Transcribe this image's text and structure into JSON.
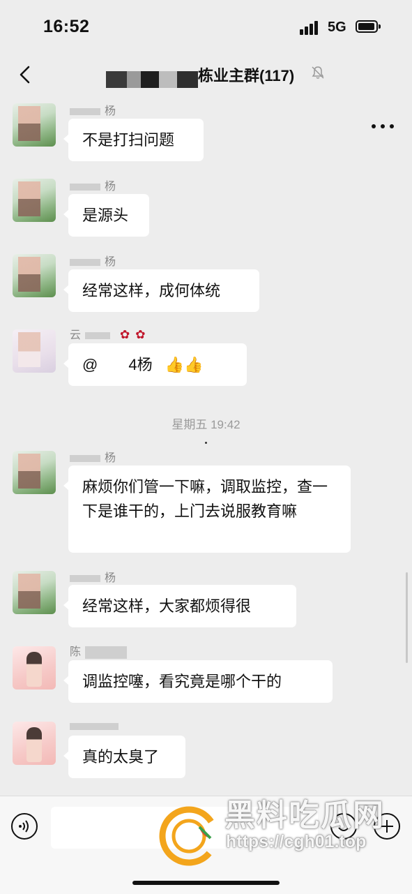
{
  "status_bar": {
    "time": "16:52",
    "network": "5G"
  },
  "header": {
    "title": "栋业主群(117)"
  },
  "messages": [
    {
      "sender": "杨",
      "text": "不是打扫问题"
    },
    {
      "sender": "杨",
      "text": "是源头"
    },
    {
      "sender": "杨",
      "text": "经常这样，成何体统"
    },
    {
      "sender": "云",
      "text": "@",
      "mention_suffix": "4杨"
    },
    {
      "sender": "杨",
      "text": "麻烦你们管一下嘛，调取监控，查一下是谁干的，上门去说服教育嘛"
    },
    {
      "sender": "杨",
      "text": "经常这样，大家都烦得很"
    },
    {
      "sender": "陈",
      "text": "调监控噻，看究竟是哪个干的"
    },
    {
      "sender": "",
      "text": "真的太臭了"
    }
  ],
  "time_separator": "星期五 19:42",
  "watermark": {
    "text": "黑料吃瓜网",
    "url": "https://cgh01.top"
  },
  "colors": {
    "background": "#ededed",
    "bubble": "#ffffff",
    "input_bar": "#f7f7f7"
  }
}
